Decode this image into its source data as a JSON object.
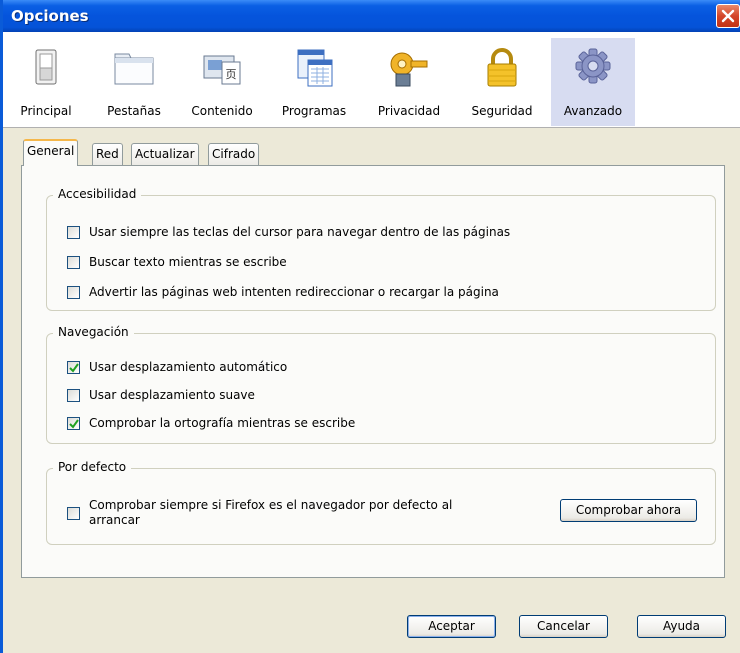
{
  "window": {
    "title": "Opciones"
  },
  "toolbar": {
    "items": [
      {
        "label": "Principal",
        "icon": "principal-icon"
      },
      {
        "label": "Pestañas",
        "icon": "tabs-icon"
      },
      {
        "label": "Contenido",
        "icon": "content-icon"
      },
      {
        "label": "Programas",
        "icon": "programs-icon"
      },
      {
        "label": "Privacidad",
        "icon": "privacy-icon"
      },
      {
        "label": "Seguridad",
        "icon": "lock-icon"
      },
      {
        "label": "Avanzado",
        "icon": "gear-icon",
        "selected": true
      }
    ]
  },
  "tabs": [
    {
      "label": "General",
      "active": true
    },
    {
      "label": "Red"
    },
    {
      "label": "Actualizar"
    },
    {
      "label": "Cifrado"
    }
  ],
  "groups": {
    "accesibilidad": {
      "title": "Accesibilidad",
      "options": [
        {
          "label": "Usar siempre las teclas del cursor para navegar dentro de las páginas",
          "checked": false
        },
        {
          "label": "Buscar texto mientras se escribe",
          "checked": false
        },
        {
          "label": "Advertir las páginas web intenten redireccionar o recargar la página",
          "checked": false
        }
      ]
    },
    "navegacion": {
      "title": "Navegación",
      "options": [
        {
          "label": "Usar desplazamiento automático",
          "checked": true
        },
        {
          "label": "Usar desplazamiento suave",
          "checked": false
        },
        {
          "label": "Comprobar la ortografía mientras se escribe",
          "checked": true
        }
      ]
    },
    "por_defecto": {
      "title": "Por defecto",
      "option": {
        "label_line1": "Comprobar siempre si Firefox es el navegador por defecto al",
        "label_line2": "arrancar",
        "checked": false
      },
      "button": "Comprobar ahora"
    }
  },
  "footer": {
    "ok": "Aceptar",
    "cancel": "Cancelar",
    "help": "Ayuda"
  },
  "colors": {
    "titlebar": "#0554dc",
    "selected_tab_accent": "#f5b74a",
    "selected_toolbar": "#d7dcf1",
    "check": "#21a121"
  }
}
